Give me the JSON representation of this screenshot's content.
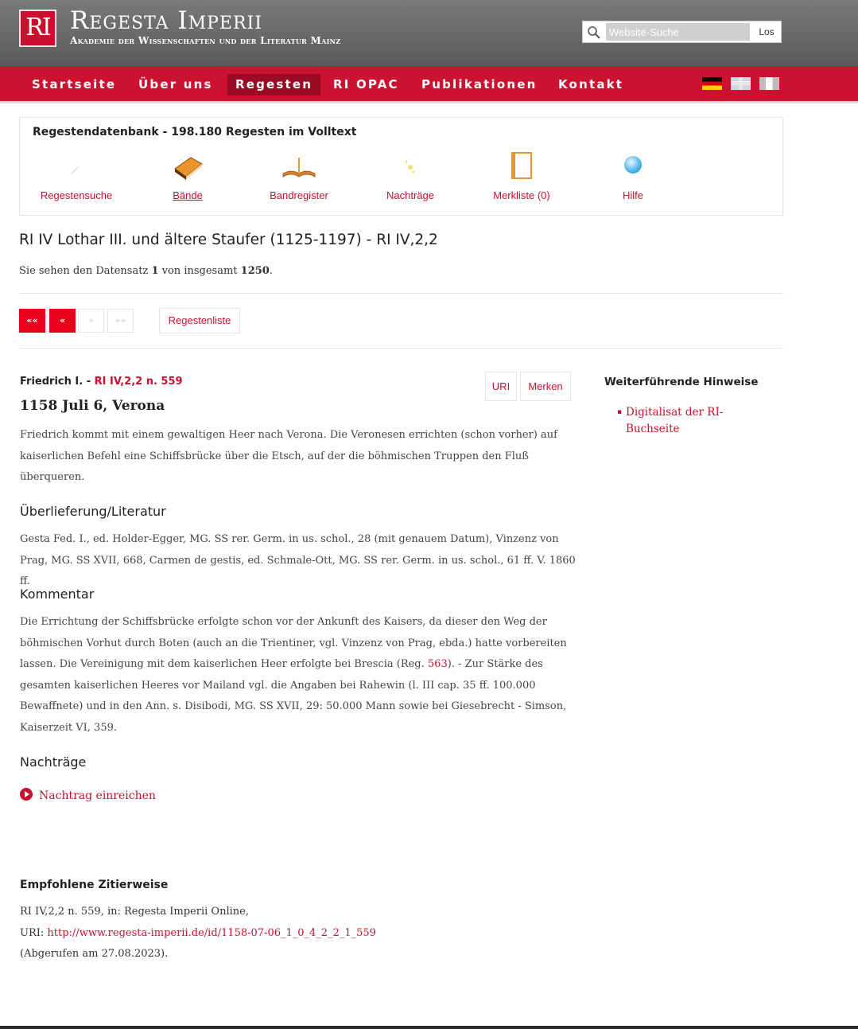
{
  "header": {
    "logo": "RI",
    "title": "Regesta Imperii",
    "subtitle": "Akademie der Wissenschaften und der Literatur Mainz",
    "search_placeholder": "Website-Suche",
    "search_button": "Los"
  },
  "nav": {
    "items": [
      {
        "label": "Startseite"
      },
      {
        "label": "Über uns"
      },
      {
        "label": "Regesten"
      },
      {
        "label": "RI OPAC"
      },
      {
        "label": "Publikationen"
      },
      {
        "label": "Kontakt"
      }
    ],
    "active": "Regesten"
  },
  "database": {
    "title": "Regestendatenbank - 198.180 Regesten im Volltext",
    "tools": [
      {
        "label": "Regestensuche",
        "icon": "pencil-icon"
      },
      {
        "label": "Bände",
        "icon": "book-icon"
      },
      {
        "label": "Bandregister",
        "icon": "open-book-icon"
      },
      {
        "label": "Nachträge",
        "icon": "sparkle-icon"
      },
      {
        "label": "Merkliste (0)",
        "icon": "notepad-icon"
      },
      {
        "label": "Hilfe",
        "icon": "help-globe-icon"
      }
    ]
  },
  "volume_title": "RI IV Lothar III. und ältere Staufer (1125-1197) - RI IV,2,2",
  "record_info": {
    "prefix": "Sie sehen den Datensatz",
    "current": "1",
    "middle": "von insgesamt",
    "total": "1250",
    "suffix": "."
  },
  "pager": {
    "first": "««",
    "prev": "«",
    "next": "»",
    "last": "»»",
    "list": "Regestenliste"
  },
  "regest": {
    "issuer": "Friedrich I. -",
    "reference": "RI IV,2,2 n. 559",
    "uri_button": "URI",
    "merken_button": "Merken",
    "date_place": "1158 Juli 6, Verona",
    "text": "Friedrich kommt mit einem gewaltigen Heer nach Verona. Die Veronesen errichten (schon vorher) auf kaiserlichen Befehl eine Schiffsbrücke über die Etsch, auf der die böhmischen Truppen den Fluß überqueren.",
    "tradition_heading": "Überlieferung/Literatur",
    "tradition_text": "Gesta Fed. I., ed. Holder-Egger, MG. SS rer. Germ. in us. schol., 28 (mit genauem Datum), Vinzenz von Prag, MG. SS XVII, 668, Carmen de gestis, ed. Schmale-Ott, MG. SS rer. Germ. in us. schol., 61 ff. V. 1860 ff.",
    "comment_heading": "Kommentar",
    "comment_part1": "Die Errichtung der Schiffsbrücke erfolgte schon vor der Ankunft des Kaisers, da dieser den Weg der böhmischen Vorhut durch Boten (auch an die Trientiner, vgl. Vinzenz von Prag, ebda.) hatte vorbereiten lassen. Die Vereinigung mit dem kaiserlichen Heer erfolgte bei Brescia (Reg.",
    "comment_link": "563",
    "comment_part2": "). - Zur Stärke des gesamten kaiserlichen Heeres vor Mailand vgl. die Angaben bei Rahewin (l. III cap. 35 ff. 100.000 Bewaffnete) und in den Ann. s. Disibodi, MG. SS XVII, 29: 50.000 Mann sowie bei Giesebrecht - Simson, Kaiserzeit VI, 359.",
    "addenda_heading": "Nachträge",
    "addenda_link": "Nachtrag einreichen"
  },
  "sidebar": {
    "heading": "Weiterführende Hinweise",
    "link": "Digitalisat der RI-Buchseite"
  },
  "citation": {
    "heading": "Empfohlene Zitierweise",
    "line1": "RI IV,2,2 n. 559, in: Regesta Imperii Online,",
    "uri_label": "URI:",
    "uri": "http://www.regesta-imperii.de/id/1158-07-06_1_0_4_2_2_1_559",
    "accessed": "(Abgerufen am 27.08.2023)."
  },
  "colors": {
    "brand_red": "#c8102e",
    "nav_active": "#9c0b24",
    "pager_active": "#e8001c"
  }
}
